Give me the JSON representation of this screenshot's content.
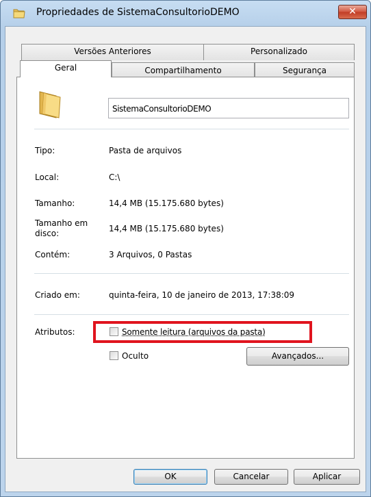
{
  "window": {
    "title": "Propriedades de SistemaConsultorioDEMO",
    "close_label": "✕"
  },
  "tabs": {
    "row1": [
      "Versões Anteriores",
      "Personalizado"
    ],
    "row2": [
      "Geral",
      "Compartilhamento",
      "Segurança"
    ],
    "active": "Geral"
  },
  "general": {
    "folder_name": "SistemaConsultorioDEMO",
    "type_label": "Tipo:",
    "type_value": "Pasta de arquivos",
    "location_label": "Local:",
    "location_value": "C:\\",
    "size_label": "Tamanho:",
    "size_value": "14,4 MB (15.175.680 bytes)",
    "disk_size_label_line1": "Tamanho em",
    "disk_size_label_line2": "disco:",
    "disk_size_value": "14,4 MB (15.175.680 bytes)",
    "contains_label": "Contém:",
    "contains_value": "3 Arquivos, 0 Pastas",
    "created_label": "Criado em:",
    "created_value": "quinta-feira, 10 de janeiro de 2013, 17:38:09",
    "attributes_label": "Atributos:",
    "readonly_label": "Somente leitura (arquivos da pasta)",
    "readonly_checked": false,
    "hidden_label": "Oculto",
    "hidden_checked": false,
    "advanced_button": "Avançados..."
  },
  "buttons": {
    "ok": "OK",
    "cancel": "Cancelar",
    "apply": "Aplicar"
  },
  "colors": {
    "highlight_box": "#e0141e"
  }
}
